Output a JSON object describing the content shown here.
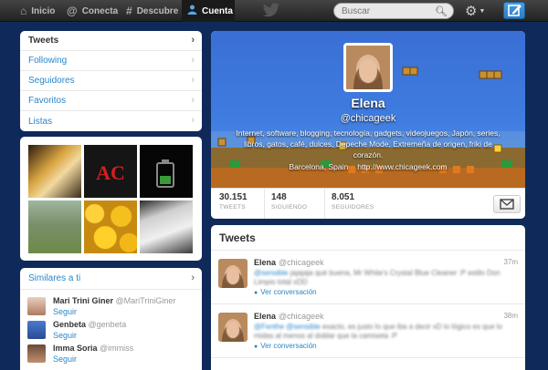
{
  "nav": {
    "home": "Inicio",
    "connect": "Conecta",
    "discover": "Descubre",
    "account": "Cuenta"
  },
  "search": {
    "placeholder": "Buscar"
  },
  "menu": {
    "items": [
      {
        "label": "Tweets"
      },
      {
        "label": "Following"
      },
      {
        "label": "Seguidores"
      },
      {
        "label": "Favoritos"
      },
      {
        "label": "Listas"
      }
    ]
  },
  "similar": {
    "title": "Similares a ti",
    "follow_label": "Seguir",
    "users": [
      {
        "name": "Mari Trini Giner",
        "handle": "@MariTriniGiner"
      },
      {
        "name": "Genbeta",
        "handle": "@genbeta"
      },
      {
        "name": "Imma Soria",
        "handle": "@immiss"
      }
    ]
  },
  "profile": {
    "name": "Elena",
    "handle": "@chicageek",
    "bio": "Internet, software, blogging, tecnología, gadgets, videojuegos, Japón, series, libros, gatos, café, dulces, Depeche Mode. Extremeña de origen, friki de corazón.",
    "location": "Barcelona, Spain",
    "url": "http://www.chicageek.com",
    "stats": {
      "tweets": {
        "value": "30.151",
        "label": "TWEETS"
      },
      "following": {
        "value": "148",
        "label": "SIGUIENDO"
      },
      "followers": {
        "value": "8.051",
        "label": "SEGUIDORES"
      }
    }
  },
  "tweets": {
    "title": "Tweets",
    "items": [
      {
        "name": "Elena",
        "handle": "@chicageek",
        "time": "37m",
        "mention": "@sensible",
        "text": "jajajaja qué buena, Mr White's Crystal Blue Cleaner :P estilo Don Limpio total xDD",
        "conversation": "Ver conversación"
      },
      {
        "name": "Elena",
        "handle": "@chicageek",
        "time": "38m",
        "mention": "@Fenthe @sensible",
        "text": "exacto, es justo lo que iba a decir xD lo lógico es que lo midas al menos al doblar que la camiseta :P",
        "conversation": "Ver conversación"
      }
    ]
  },
  "colors": {
    "background": "#0f2a5a",
    "link": "#2a86c8",
    "accent": "#5aa7e6"
  }
}
